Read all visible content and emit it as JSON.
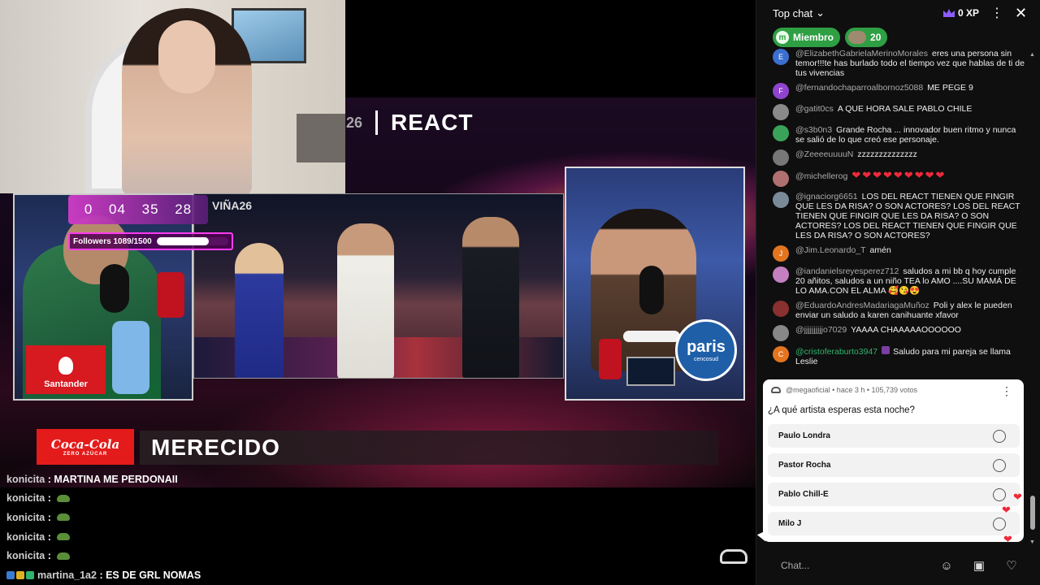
{
  "video": {
    "react_bar": {
      "vina_logo": "26",
      "title": "REACT"
    },
    "center_logo": "VIÑA26",
    "timer": [
      "0",
      "04",
      "35",
      "28"
    ],
    "followers": {
      "label": "Followers 1089/1500",
      "progress": 0.726
    },
    "santander_label": "Santander",
    "paris_label": "paris",
    "paris_sub": "cencosud",
    "cocacola": {
      "brand": "Coca-Cola",
      "sub": "ZERO AZÚCAR"
    },
    "headline": "MERECIDO",
    "stream_chat": [
      {
        "user": "konicita",
        "text": "MARTINA ME PERDONAII",
        "emote": false,
        "badges": false
      },
      {
        "user": "konicita",
        "text": "",
        "emote": true,
        "badges": false
      },
      {
        "user": "konicita",
        "text": "",
        "emote": true,
        "badges": false
      },
      {
        "user": "konicita",
        "text": "",
        "emote": true,
        "badges": false
      },
      {
        "user": "konicita",
        "text": "",
        "emote": true,
        "badges": false
      },
      {
        "user": "martina_1a2",
        "text": "ES DE GRL NOMAS",
        "emote": false,
        "badges": true
      }
    ]
  },
  "chat": {
    "header": {
      "title": "Top chat",
      "xp": "0 XP"
    },
    "chips": {
      "member": "Miembro",
      "count": "20"
    },
    "messages": [
      {
        "author": "@ElizabethGabrielaMerinoMorales",
        "text": "eres una persona sin temor!!!te has burlado todo el tiempo vez que hablas de ti de tus vivencias",
        "avatar": "E",
        "color": "#3b6fd1"
      },
      {
        "author": "@fernandochaparroalbornoz5088",
        "text": "ME PEGE 9",
        "avatar": "F",
        "color": "#8e44cf"
      },
      {
        "author": "@gatit0cs",
        "text": "A QUE HORA SALE PABLO CHILE",
        "avatar": "",
        "color": "#8a8a8a"
      },
      {
        "author": "@s3b0n3",
        "text": "Grande Rocha ... innovador buen ritmo y nunca se salió de lo que creó ese personaje.",
        "avatar": "",
        "color": "#3aa35a"
      },
      {
        "author": "@ZeeeeuuuuN",
        "text": "zzzzzzzzzzzzzz",
        "avatar": "",
        "color": "#777"
      },
      {
        "author": "@michellerog",
        "text": "",
        "avatar": "",
        "color": "#b07070",
        "hearts": "❤❤❤❤❤❤❤❤❤"
      },
      {
        "author": "@ignaciorg6651",
        "text": "LOS DEL REACT TIENEN QUE FINGIR QUE LES DA RISA? O SON ACTORES? LOS DEL REACT TIENEN QUE FINGIR QUE LES DA RISA? O SON ACTORES? LOS DEL REACT TIENEN QUE FINGIR QUE LES DA RISA? O SON ACTORES?",
        "avatar": "",
        "color": "#7a8a99"
      },
      {
        "author": "@Jim.Leonardo_T",
        "text": "amén",
        "avatar": "J",
        "color": "#e4751f"
      },
      {
        "author": "@iandanielsreyesperez712",
        "text": "saludos a mi bb q hoy cumple 20 añitos, saludos a un niño TEA lo AMO ....SU MAMÁ DE LO AMA.CON EL ALMA 🥰😘😍",
        "avatar": "",
        "color": "#c47fc0"
      },
      {
        "author": "@EduardoAndresMadariagaMuñoz",
        "text": "Poli y alex le pueden enviar un saludo a karen canihuante xfavor",
        "avatar": "",
        "color": "#8a3030"
      },
      {
        "author": "@jjjjjjjjjjo7029",
        "text": "YAAAA CHAAAAAOOOOOO",
        "avatar": "",
        "color": "#888"
      },
      {
        "author": "@cristoferaburto3947",
        "text": "Saludo para mi pareja se llama Leslie",
        "avatar": "C",
        "color": "#e4751f",
        "member": true
      }
    ],
    "poll": {
      "meta": "@megaoficial • hace 3 h • 105,739 votos",
      "question": "¿A qué artista esperas esta noche?",
      "options": [
        "Paulo Londra",
        "Pastor Rocha",
        "Pablo Chill-E",
        "Milo J"
      ]
    },
    "input_placeholder": "Chat..."
  }
}
